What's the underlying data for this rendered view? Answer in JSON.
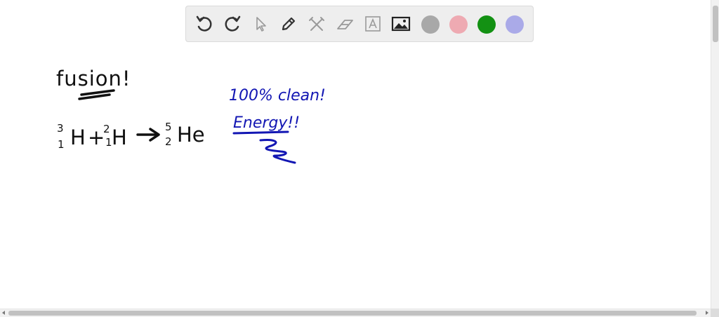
{
  "toolbar": {
    "tools": [
      "undo-icon",
      "redo-icon",
      "select-pointer-icon",
      "pen-icon",
      "tools-icon",
      "eraser-icon",
      "text-box-icon",
      "image-icon"
    ],
    "colors": [
      "#a8a8a8",
      "#eeaab2",
      "#139113",
      "#aaaae8"
    ]
  },
  "board": {
    "heading": "fusion!",
    "equation": {
      "reactant1_mass": "3",
      "reactant1_atomic": "1",
      "reactant1_symbol": "H",
      "plus": "+",
      "reactant2_mass": "2",
      "reactant2_atomic": "1",
      "reactant2_symbol": "H",
      "product_mass": "5",
      "product_atomic": "2",
      "product_symbol": "He"
    },
    "note_line1": "100% clean!",
    "note_line2": "Energy!!",
    "ink_colors": {
      "black": "#111111",
      "blue": "#1216b3"
    }
  }
}
